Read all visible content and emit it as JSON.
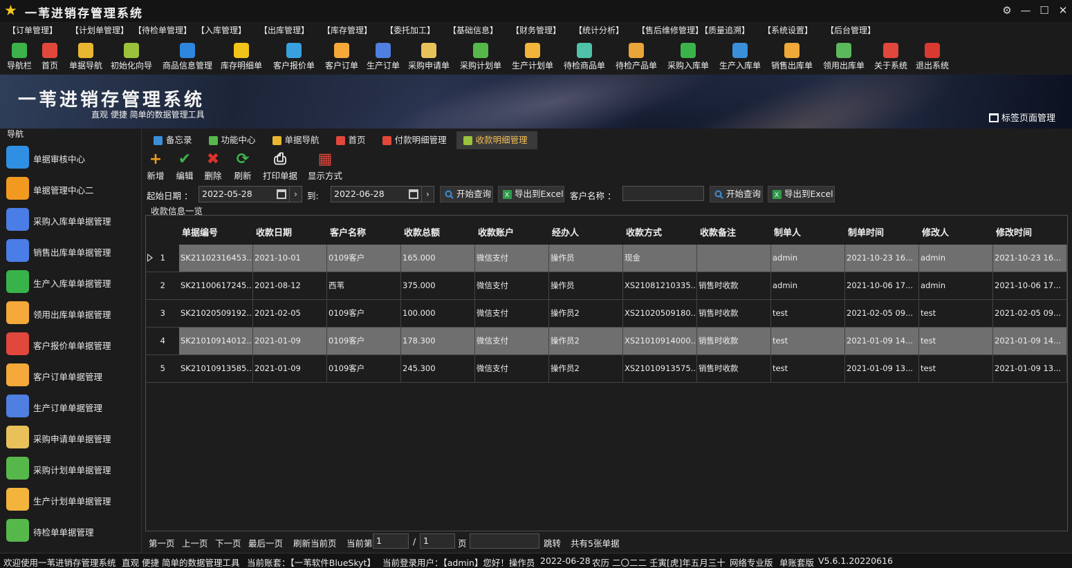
{
  "app": {
    "title": "一苇进销存管理系统"
  },
  "window_controls": [
    "gear-icon",
    "minimize-icon",
    "maximize-icon",
    "close-icon"
  ],
  "menu": [
    "【订单管理】",
    "【计划单管理】",
    "【待检单管理】",
    "【入库管理】",
    "【出库管理】",
    "【库存管理】",
    "【委托加工】",
    "【基础信息】",
    "【财务管理】",
    "【统计分析】",
    "【售后维修管理】",
    "【质量追溯】",
    "【系统设置】",
    "【后台管理】"
  ],
  "toolbar": [
    {
      "label": "导航栏",
      "icon": "menu-icon",
      "color": "#3cb34a"
    },
    {
      "label": "首页",
      "icon": "home-icon",
      "color": "#e2473b"
    },
    {
      "label": "单据导航",
      "icon": "plane-icon",
      "color": "#e8b630"
    },
    {
      "label": "初始化向导",
      "icon": "wand-icon",
      "color": "#9ac23b"
    },
    {
      "label": "商品信息管理",
      "icon": "cubes-icon",
      "color": "#2e86de"
    },
    {
      "label": "库存明细单",
      "icon": "warning-icon",
      "color": "#f2c318"
    },
    {
      "label": "客户报价单",
      "icon": "tag-icon",
      "color": "#39a0e0"
    },
    {
      "label": "客户订单",
      "icon": "doc-icon",
      "color": "#f4a93a"
    },
    {
      "label": "生产订单",
      "icon": "doc-icon",
      "color": "#4f7fe0"
    },
    {
      "label": "采购申请单",
      "icon": "note-icon",
      "color": "#e8c15a"
    },
    {
      "label": "采购计划单",
      "icon": "chat-icon",
      "color": "#56b84b"
    },
    {
      "label": "生产计划单",
      "icon": "chat-icon",
      "color": "#f3b43c"
    },
    {
      "label": "待检商品单",
      "icon": "flask-icon",
      "color": "#4fc3a9"
    },
    {
      "label": "待检产品单",
      "icon": "flask-icon",
      "color": "#e9a43a"
    },
    {
      "label": "采购入库单",
      "icon": "plus-icon",
      "color": "#3cb34a"
    },
    {
      "label": "生产入库单",
      "icon": "cart-icon",
      "color": "#3a8fd9"
    },
    {
      "label": "销售出库单",
      "icon": "box-out-icon",
      "color": "#f0a838"
    },
    {
      "label": "领用出库单",
      "icon": "download-icon",
      "color": "#5cb85c"
    },
    {
      "label": "关于系统",
      "icon": "home-icon",
      "color": "#e2473b"
    },
    {
      "label": "退出系统",
      "icon": "exit-icon",
      "color": "#d83a32"
    }
  ],
  "banner": {
    "title": "一苇进销存管理系统",
    "subtitle": "直观 便捷 简单的数据管理工具",
    "tag_button": "标签页面管理"
  },
  "nav": {
    "header": "导航",
    "items": [
      {
        "label": "单据审核中心",
        "icon": "grid-icon",
        "color": "#2f8fe3"
      },
      {
        "label": "单据管理中心二",
        "icon": "grid-icon",
        "color": "#f29a1f"
      },
      {
        "label": "采购入库单单据管理",
        "icon": "arrow-left-icon",
        "color": "#4a7de6"
      },
      {
        "label": "销售出库单单据管理",
        "icon": "arrow-right-icon",
        "color": "#4a7de6"
      },
      {
        "label": "生产入库单单据管理",
        "icon": "folder-icon",
        "color": "#38b34a"
      },
      {
        "label": "领用出库单单据管理",
        "icon": "doc-icon",
        "color": "#f4a93a"
      },
      {
        "label": "客户报价单单据管理",
        "icon": "books-icon",
        "color": "#e2473b"
      },
      {
        "label": "客户订单单据管理",
        "icon": "doc-icon",
        "color": "#f4a93a"
      },
      {
        "label": "生产订单单据管理",
        "icon": "doc-icon",
        "color": "#4f7fe0"
      },
      {
        "label": "采购申请单单据管理",
        "icon": "envelope-icon",
        "color": "#e8c15a"
      },
      {
        "label": "采购计划单单据管理",
        "icon": "chat-icon",
        "color": "#56b84b"
      },
      {
        "label": "生产计划单单据管理",
        "icon": "chat-icon",
        "color": "#f3b43c"
      },
      {
        "label": "待检单单据管理",
        "icon": "clipboard-icon",
        "color": "#56b84b"
      }
    ]
  },
  "tabs": [
    {
      "label": "备忘录",
      "icon": "memo-icon",
      "color": "#3a8fd9"
    },
    {
      "label": "功能中心",
      "icon": "grid-icon",
      "color": "#56b84b"
    },
    {
      "label": "单据导航",
      "icon": "plane-icon",
      "color": "#e8b630"
    },
    {
      "label": "首页",
      "icon": "home-icon",
      "color": "#e2473b"
    },
    {
      "label": "付款明细管理",
      "icon": "payment-icon",
      "color": "#e2473b"
    },
    {
      "label": "收款明细管理",
      "icon": "receipt-icon",
      "color": "#9ac23b",
      "active": true
    }
  ],
  "actions": [
    {
      "label": "新增",
      "icon": "plus-icon",
      "color": "#f39b1f"
    },
    {
      "label": "编辑",
      "icon": "check-icon",
      "color": "#3cb34a"
    },
    {
      "label": "删除",
      "icon": "x-icon",
      "color": "#e0322a"
    },
    {
      "label": "刷新",
      "icon": "refresh-icon",
      "color": "#3cb34a"
    },
    {
      "label": "打印单据",
      "icon": "printer-icon",
      "color": "#eeeeee"
    },
    {
      "label": "显示方式",
      "icon": "grid-icon",
      "color": "#e2473b"
    }
  ],
  "filter": {
    "start_label": "起始日期 ：",
    "start_value": "2022-05-28",
    "to_label": "到:",
    "end_value": "2022-06-28",
    "query_button": "开始查询",
    "export_button": "导出到Excel",
    "customer_label": "客户名称 ：",
    "customer_value": "",
    "query_button2": "开始查询",
    "export_button2": "导出到Excel"
  },
  "group_label": "收款信息一览",
  "grid": {
    "columns": [
      "单据编号",
      "收款日期",
      "客户名称",
      "收款总额",
      "收款账户",
      "经办人",
      "收款方式",
      "收款备注",
      "制单人",
      "制单时间",
      "修改人",
      "修改时间"
    ],
    "rows": [
      {
        "n": "1",
        "cells": [
          "SK21102316453...",
          "2021-10-01",
          "0109客户",
          "165.000",
          "微信支付",
          "操作员",
          "现金",
          "",
          "admin",
          "2021-10-23 16...",
          "admin",
          "2021-10-23 16..."
        ]
      },
      {
        "n": "2",
        "cells": [
          "SK21100617245...",
          "2021-08-12",
          "西苇",
          "375.000",
          "微信支付",
          "操作员",
          "XS21081210335...",
          "销售时收款",
          "admin",
          "2021-10-06 17...",
          "admin",
          "2021-10-06 17..."
        ]
      },
      {
        "n": "3",
        "cells": [
          "SK21020509192...",
          "2021-02-05",
          "0109客户",
          "100.000",
          "微信支付",
          "操作员2",
          "XS21020509180...",
          "销售时收款",
          "test",
          "2021-02-05 09...",
          "test",
          "2021-02-05 09..."
        ]
      },
      {
        "n": "4",
        "cells": [
          "SK21010914012...",
          "2021-01-09",
          "0109客户",
          "178.300",
          "微信支付",
          "操作员2",
          "XS21010914000...",
          "销售时收款",
          "test",
          "2021-01-09 14...",
          "test",
          "2021-01-09 14..."
        ]
      },
      {
        "n": "5",
        "cells": [
          "SK21010913585...",
          "2021-01-09",
          "0109客户",
          "245.300",
          "微信支付",
          "操作员2",
          "XS21010913575...",
          "销售时收款",
          "test",
          "2021-01-09 13...",
          "test",
          "2021-01-09 13..."
        ]
      }
    ]
  },
  "pager": {
    "first": "第一页",
    "prev": "上一页",
    "next": "下一页",
    "last": "最后一页",
    "refresh": "刷新当前页",
    "current_label": "当前第",
    "current_value": "1",
    "sep": "/",
    "total_value": "1",
    "page_label": "页",
    "jump_value": "",
    "jump": "跳转",
    "count": "共有5张单据"
  },
  "status": [
    "欢迎使用一苇进销存管理系统",
    "直观 便捷 简单的数据管理工具",
    "当前账套：【一苇软件BlueSkyt】",
    "当前登录用户：【admin】您好！操作员",
    "2022-06-28",
    "农历 二〇二二 壬寅[虎]年五月三十",
    "网络专业版",
    "单账套版",
    "V5.6.1.20220616"
  ]
}
